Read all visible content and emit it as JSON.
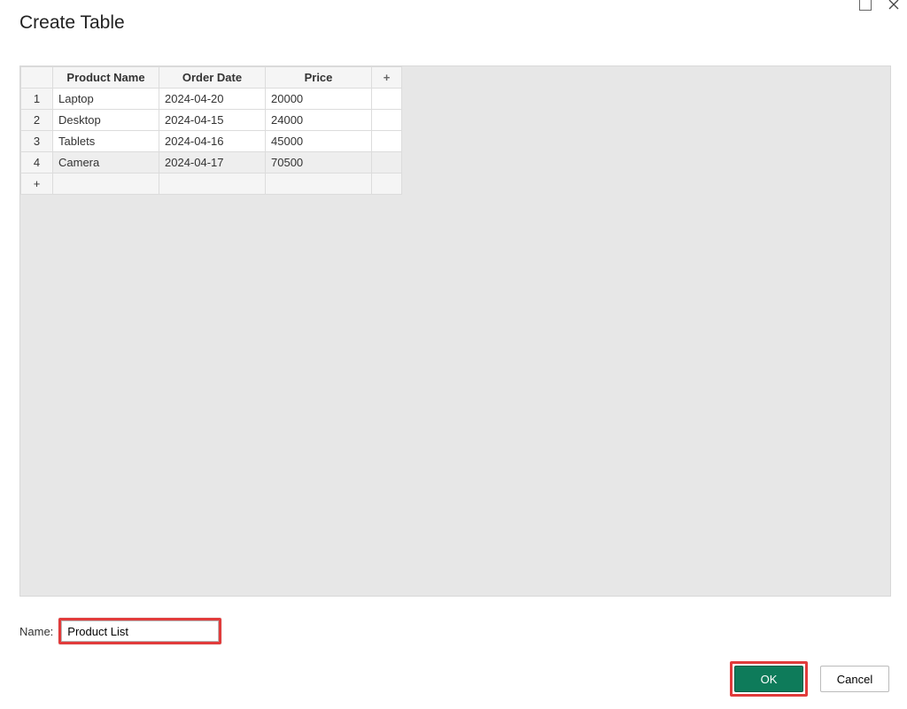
{
  "window": {
    "title": "Create Table"
  },
  "table": {
    "columns": [
      "Product Name",
      "Order Date",
      "Price"
    ],
    "add_col_symbol": "+",
    "add_row_symbol": "+",
    "rows": [
      {
        "num": "1",
        "product": "Laptop",
        "date": "2024-04-20",
        "price": "20000"
      },
      {
        "num": "2",
        "product": "Desktop",
        "date": "2024-04-15",
        "price": "24000"
      },
      {
        "num": "3",
        "product": "Tablets",
        "date": "2024-04-16",
        "price": "45000"
      },
      {
        "num": "4",
        "product": "Camera",
        "date": "2024-04-17",
        "price": "70500"
      }
    ]
  },
  "nameField": {
    "label": "Name:",
    "value": "Product List"
  },
  "buttons": {
    "ok": "OK",
    "cancel": "Cancel"
  }
}
